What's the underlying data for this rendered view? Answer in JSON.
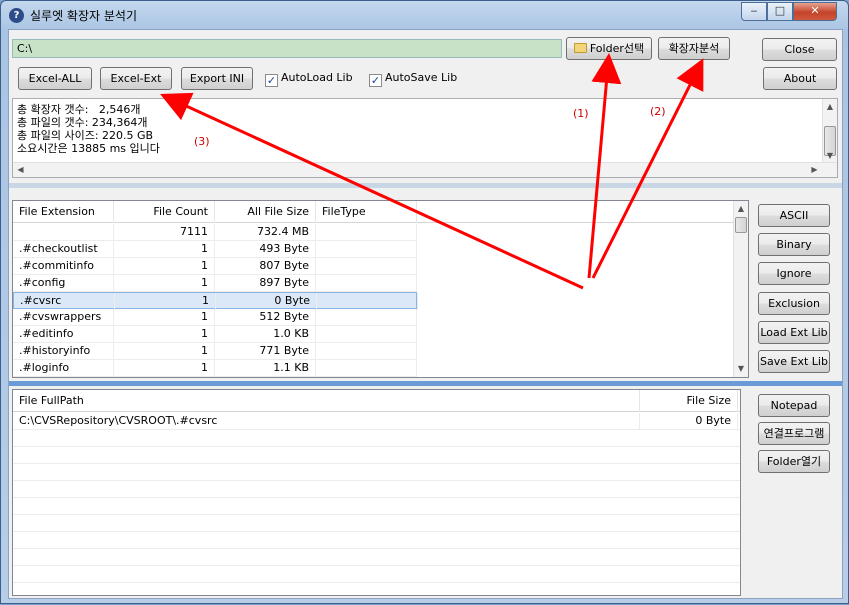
{
  "window": {
    "title": "실루엣 확장자 분석기",
    "icon": "question-icon"
  },
  "window_controls": {
    "minimize": "‒",
    "maximize": "□",
    "close": "✕"
  },
  "toolbar": {
    "path_value": "C:\\",
    "folder_button": "Folder선택",
    "analyze_button": "확장자분석",
    "close_button": "Close",
    "about_button": "About",
    "excel_all": "Excel-ALL",
    "excel_ext": "Excel-Ext",
    "export_ini": "Export INI",
    "autoload": {
      "label": "AutoLoad Lib",
      "checked": true
    },
    "autosave": {
      "label": "AutoSave Lib",
      "checked": true
    }
  },
  "summary": {
    "line1_label": "총 확장자 갯수:",
    "line1_value": "2,546개",
    "line2_label": "총 파일의 갯수:",
    "line2_value": "234,364개",
    "line3_label": "총 파일의 사이즈:",
    "line3_value": "220.5 GB",
    "line4": "소요시간은 13885 ms 입니다"
  },
  "annotations": {
    "a1": "(1)",
    "a2": "(2)",
    "a3": "(3)"
  },
  "extensions_table": {
    "columns": [
      "File Extension",
      "File Count",
      "All File Size",
      "FileType"
    ],
    "rows": [
      {
        "ext": "",
        "count": "7111",
        "size": "732.4 MB",
        "type": ""
      },
      {
        "ext": ".#checkoutlist",
        "count": "1",
        "size": "493 Byte",
        "type": ""
      },
      {
        "ext": ".#commitinfo",
        "count": "1",
        "size": "807 Byte",
        "type": ""
      },
      {
        "ext": ".#config",
        "count": "1",
        "size": "897 Byte",
        "type": ""
      },
      {
        "ext": ".#cvsrc",
        "count": "1",
        "size": "0 Byte",
        "type": ""
      },
      {
        "ext": ".#cvswrappers",
        "count": "1",
        "size": "512 Byte",
        "type": ""
      },
      {
        "ext": ".#editinfo",
        "count": "1",
        "size": "1.0 KB",
        "type": ""
      },
      {
        "ext": ".#historyinfo",
        "count": "1",
        "size": "771 Byte",
        "type": ""
      },
      {
        "ext": ".#loginfo",
        "count": "1",
        "size": "1.1 KB",
        "type": ""
      }
    ]
  },
  "side_buttons": [
    "ASCII",
    "Binary",
    "Ignore",
    "Exclusion",
    "Load Ext Lib",
    "Save Ext Lib"
  ],
  "files_table": {
    "columns": [
      "File FullPath",
      "File Size"
    ],
    "rows": [
      {
        "path": "C:\\CVSRepository\\CVSROOT\\.#cvsrc",
        "size": "0 Byte"
      }
    ]
  },
  "file_buttons": [
    "Notepad",
    "연결프로그램",
    "Folder열기"
  ]
}
